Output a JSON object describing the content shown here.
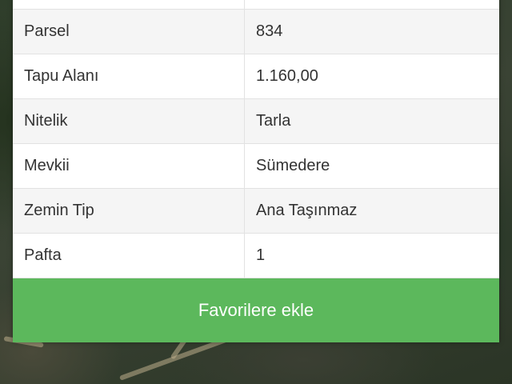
{
  "details": {
    "rows": [
      {
        "label": "",
        "value": ""
      },
      {
        "label": "Parsel",
        "value": "834"
      },
      {
        "label": "Tapu Alanı",
        "value": "1.160,00"
      },
      {
        "label": "Nitelik",
        "value": "Tarla"
      },
      {
        "label": "Mevkii",
        "value": "Sümedere"
      },
      {
        "label": "Zemin Tip",
        "value": "Ana Taşınmaz"
      },
      {
        "label": "Pafta",
        "value": "1"
      }
    ]
  },
  "actions": {
    "favorite_label": "Favorilere ekle"
  },
  "colors": {
    "accent_green": "#5cb85c",
    "row_alt": "#f5f5f5",
    "border": "#e2e2e2"
  }
}
